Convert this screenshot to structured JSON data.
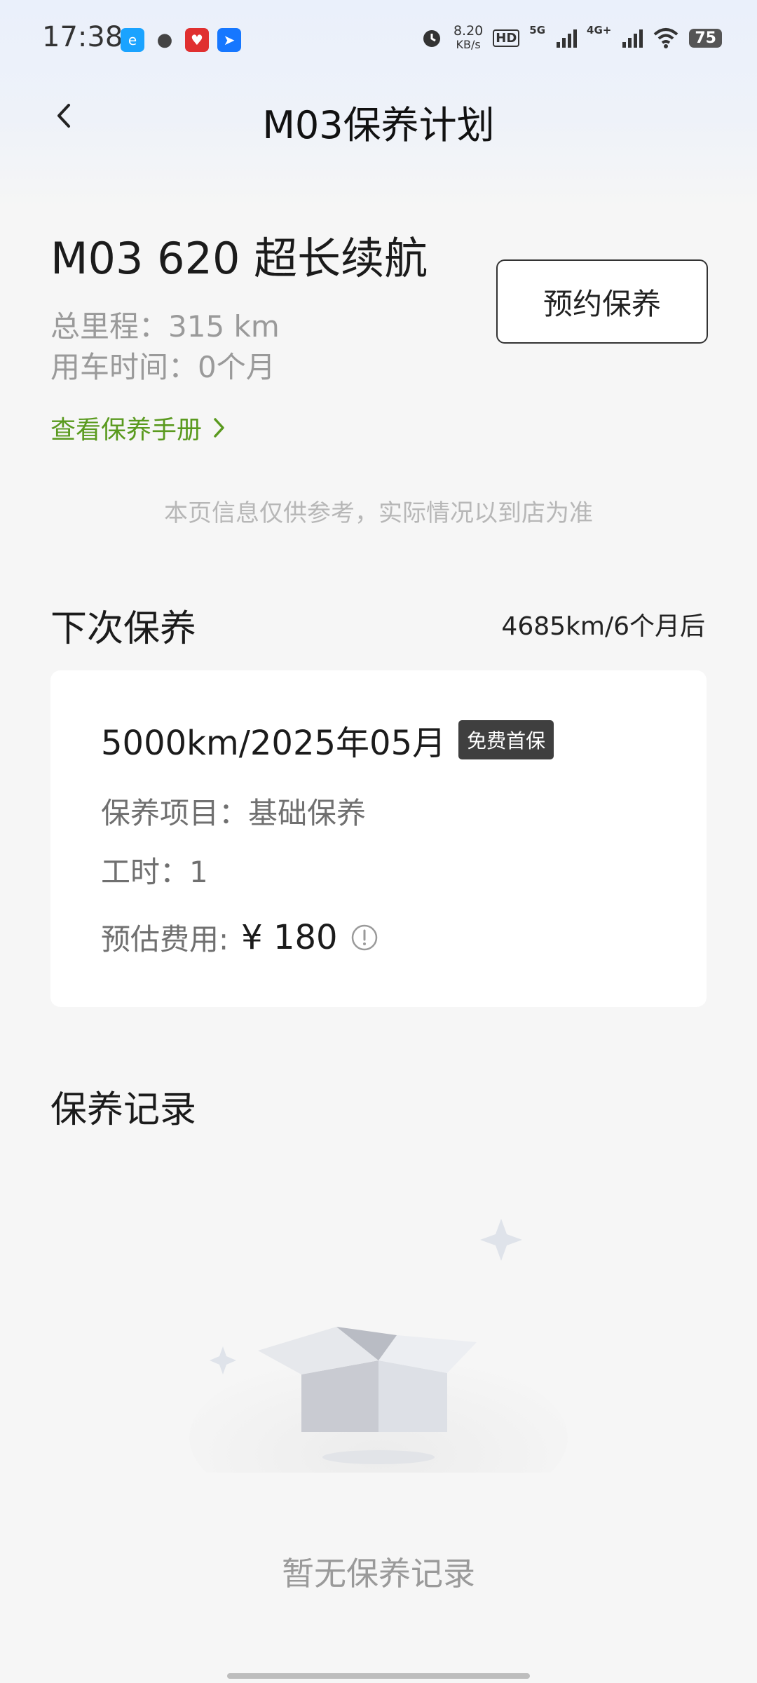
{
  "status_bar": {
    "time": "17:38",
    "net_speed": "8.20",
    "net_unit": "KB/s",
    "hd": "HD",
    "sig1": "5G",
    "sig2": "4G+",
    "battery": "75"
  },
  "nav": {
    "title": "M03保养计划"
  },
  "car": {
    "model": "M03 620 超长续航",
    "mileage": "总里程：315 km",
    "usage": "用车时间：0个月",
    "manual_link": "查看保养手册"
  },
  "book_button": "预约保养",
  "disclaimer": "本页信息仅供参考，实际情况以到店为准",
  "next": {
    "title": "下次保养",
    "due": "4685km/6个月后",
    "target": "5000km/2025年05月",
    "badge": "免费首保",
    "items": "保养项目：基础保养",
    "hours": "工时：1",
    "cost_label": "预估费用:",
    "cost_value": "¥ 180"
  },
  "records": {
    "title": "保养记录",
    "empty_text": "暂无保养记录"
  }
}
